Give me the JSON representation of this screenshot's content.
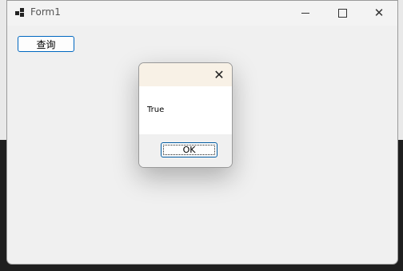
{
  "window": {
    "title": "Form1",
    "icon": "app-icon"
  },
  "toolbar": {
    "query_label": "查询"
  },
  "dialog": {
    "message": "True",
    "ok_label": "OK"
  }
}
